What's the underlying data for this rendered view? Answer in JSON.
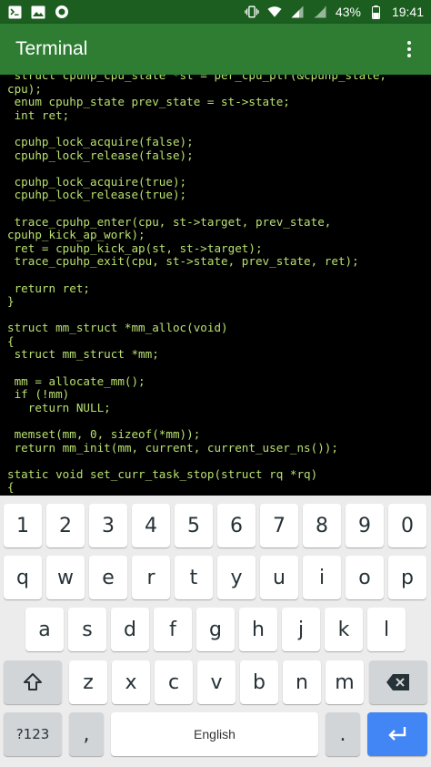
{
  "status_bar": {
    "battery": "43%",
    "time": "19:41",
    "bg_color": "#1b5e20"
  },
  "app_bar": {
    "title": "Terminal",
    "bg_color": "#2e7d32"
  },
  "terminal": {
    "text_color": "#b8e070",
    "lines": [
      " struct cpuhp_cpu_state *st = per_cpu_ptr(&cpuhp_state,",
      "cpu);",
      " enum cpuhp_state prev_state = st->state;",
      " int ret;",
      "",
      " cpuhp_lock_acquire(false);",
      " cpuhp_lock_release(false);",
      "",
      " cpuhp_lock_acquire(true);",
      " cpuhp_lock_release(true);",
      "",
      " trace_cpuhp_enter(cpu, st->target, prev_state,",
      "cpuhp_kick_ap_work);",
      " ret = cpuhp_kick_ap(st, st->target);",
      " trace_cpuhp_exit(cpu, st->state, prev_state, ret);",
      "",
      " return ret;",
      "}",
      "",
      "struct mm_struct *mm_alloc(void)",
      "{",
      " struct mm_struct *mm;",
      "",
      " mm = allocate_mm();",
      " if (!mm)",
      "   return NULL;",
      "",
      " memset(mm, 0, sizeof(*mm));",
      " return mm_init(mm, current, current_user_ns());",
      "",
      "static void set_curr_task_stop(struct rq *rq)",
      "{"
    ]
  },
  "keyboard": {
    "number_row": [
      "1",
      "2",
      "3",
      "4",
      "5",
      "6",
      "7",
      "8",
      "9",
      "0"
    ],
    "row1": [
      "q",
      "w",
      "e",
      "r",
      "t",
      "y",
      "u",
      "i",
      "o",
      "p"
    ],
    "row2": [
      "a",
      "s",
      "d",
      "f",
      "g",
      "h",
      "j",
      "k",
      "l"
    ],
    "row3": [
      "z",
      "x",
      "c",
      "v",
      "b",
      "n",
      "m"
    ],
    "symbols_label": "?123",
    "comma_label": ",",
    "space_label": "English",
    "period_label": ".",
    "enter_color": "#4285f4",
    "icons": {
      "shift": "shift-arrow-icon",
      "backspace": "backspace-icon",
      "enter": "enter-arrow-icon"
    }
  }
}
